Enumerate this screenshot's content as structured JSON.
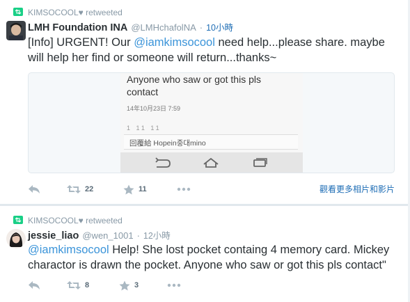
{
  "tweet1": {
    "retweeted_by": "KIMSOCOOL♥ retweeted",
    "name": "LMH Foundation INA",
    "handle": "@LMHchafolNA",
    "separator": "·",
    "time": "10小時",
    "text_before": "[Info] URGENT! Our ",
    "mention": "@iamkimsocool",
    "text_after": " need help...please share. maybe will help her find or someone will return...thanks~",
    "media": {
      "message": "Anyone who saw or got this pls contact",
      "date": "14年10月23日 7:59",
      "smudge": "1 11 11",
      "reply_placeholder": "回覆給 Hopein중대mino"
    },
    "actions": {
      "retweets": "22",
      "favorites": "11"
    },
    "more_media_link": "觀看更多相片和影片"
  },
  "tweet2": {
    "retweeted_by": "KIMSOCOOL♥ retweeted",
    "name": "jessie_liao",
    "handle": "@wen_1001",
    "separator": "·",
    "time": "12小時",
    "mention": "@iamkimsocool",
    "text_after": " Help! She lost pocket containg 4 memory card. Mickey charactor is drawn the pocket. Anyone who saw or got this pls contact\"",
    "actions": {
      "retweets": "8",
      "favorites": "3"
    }
  },
  "colors": {
    "link": "#3b94d9",
    "time_link": "#1e6db5",
    "retweet_green": "#19cf86",
    "muted": "#8899a6"
  },
  "icons": [
    "retweet-icon",
    "reply-icon",
    "favorite-star-icon",
    "more-dots-icon",
    "back-icon",
    "home-icon",
    "recents-icon"
  ]
}
